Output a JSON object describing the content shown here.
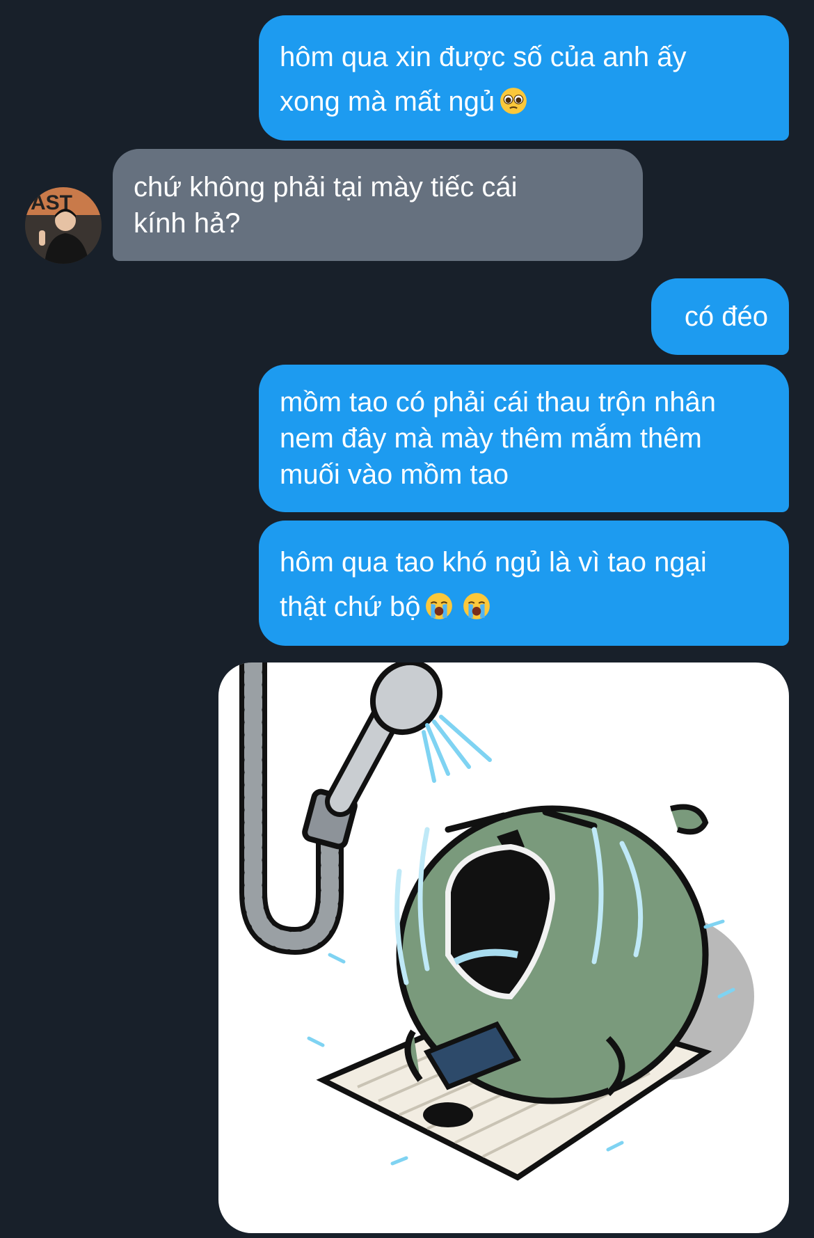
{
  "messages": [
    {
      "direction": "outgoing",
      "lines": [
        "hôm qua xin được số của anh ấy",
        "xong mà mất ngủ"
      ],
      "emoji": [
        "pleading-face-emoji"
      ]
    },
    {
      "direction": "incoming",
      "lines": [
        "chứ không phải tại mày tiếc cái",
        "kính hả?"
      ]
    },
    {
      "direction": "outgoing",
      "lines": [
        "có đéo"
      ]
    },
    {
      "direction": "outgoing",
      "lines": [
        "mồm tao có phải cái thau trộn nhân",
        "nem đây mà mày thêm mắm thêm",
        "muối vào mồm tao"
      ]
    },
    {
      "direction": "outgoing",
      "lines": [
        "hôm qua tao khó ngủ là vì tao ngại",
        "thật chứ bộ"
      ],
      "emoji": [
        "loudly-crying-face-emoji",
        "loudly-crying-face-emoji"
      ]
    },
    {
      "direction": "outgoing",
      "type": "sticker",
      "sticker": "crying-green-blob-under-shower-sticker"
    }
  ],
  "colors": {
    "background": "#18202a",
    "outgoing_bubble": "#1d9bf0",
    "incoming_bubble": "#66717f",
    "text": "#ffffff"
  },
  "avatar": "contact-avatar"
}
